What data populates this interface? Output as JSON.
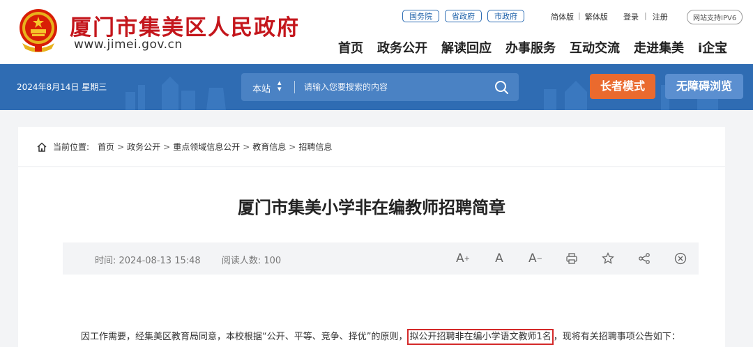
{
  "header": {
    "site_title": "厦门市集美区人民政府",
    "site_url": "www.jimei.gov.cn",
    "gov_links": [
      "国务院",
      "省政府",
      "市政府"
    ],
    "lang_links": [
      "简体版",
      "繁体版"
    ],
    "login": "登录",
    "register": "注册",
    "ipv6": "网站支持IPV6",
    "nav": [
      "首页",
      "政务公开",
      "解读回应",
      "办事服务",
      "互动交流",
      "走进集美",
      "i企宝"
    ]
  },
  "banner": {
    "date": "2024年8月14日 星期三",
    "search_scope": "本站",
    "search_placeholder": "请输入您要搜索的内容",
    "elder_mode": "长者模式",
    "accessibility": "无障碍浏览"
  },
  "breadcrumb": {
    "label": "当前位置:",
    "items": [
      "首页",
      "政务公开",
      "重点领域信息公开",
      "教育信息",
      "招聘信息"
    ]
  },
  "article": {
    "title": "厦门市集美小学非在编教师招聘简章",
    "time_label": "时间: 2024-08-13 15:48",
    "views_label": "阅读人数: 100",
    "tools": [
      "font-increase-icon",
      "font-normal-icon",
      "font-decrease-icon",
      "print-icon",
      "star-icon",
      "share-icon",
      "close-icon"
    ],
    "para_before": "因工作需要，经集美区教育局同意，本校根据“公开、平等、竞争、择优”的原则，",
    "para_highlight": "拟公开招聘非在编小学语文教师1名",
    "para_after": "，现将有关招聘事项公告如下："
  },
  "colors": {
    "brand_red": "#c4161c",
    "banner_blue": "#2f6cb3",
    "elder_orange": "#ea6a2e",
    "highlight_red": "#d42a2a"
  }
}
